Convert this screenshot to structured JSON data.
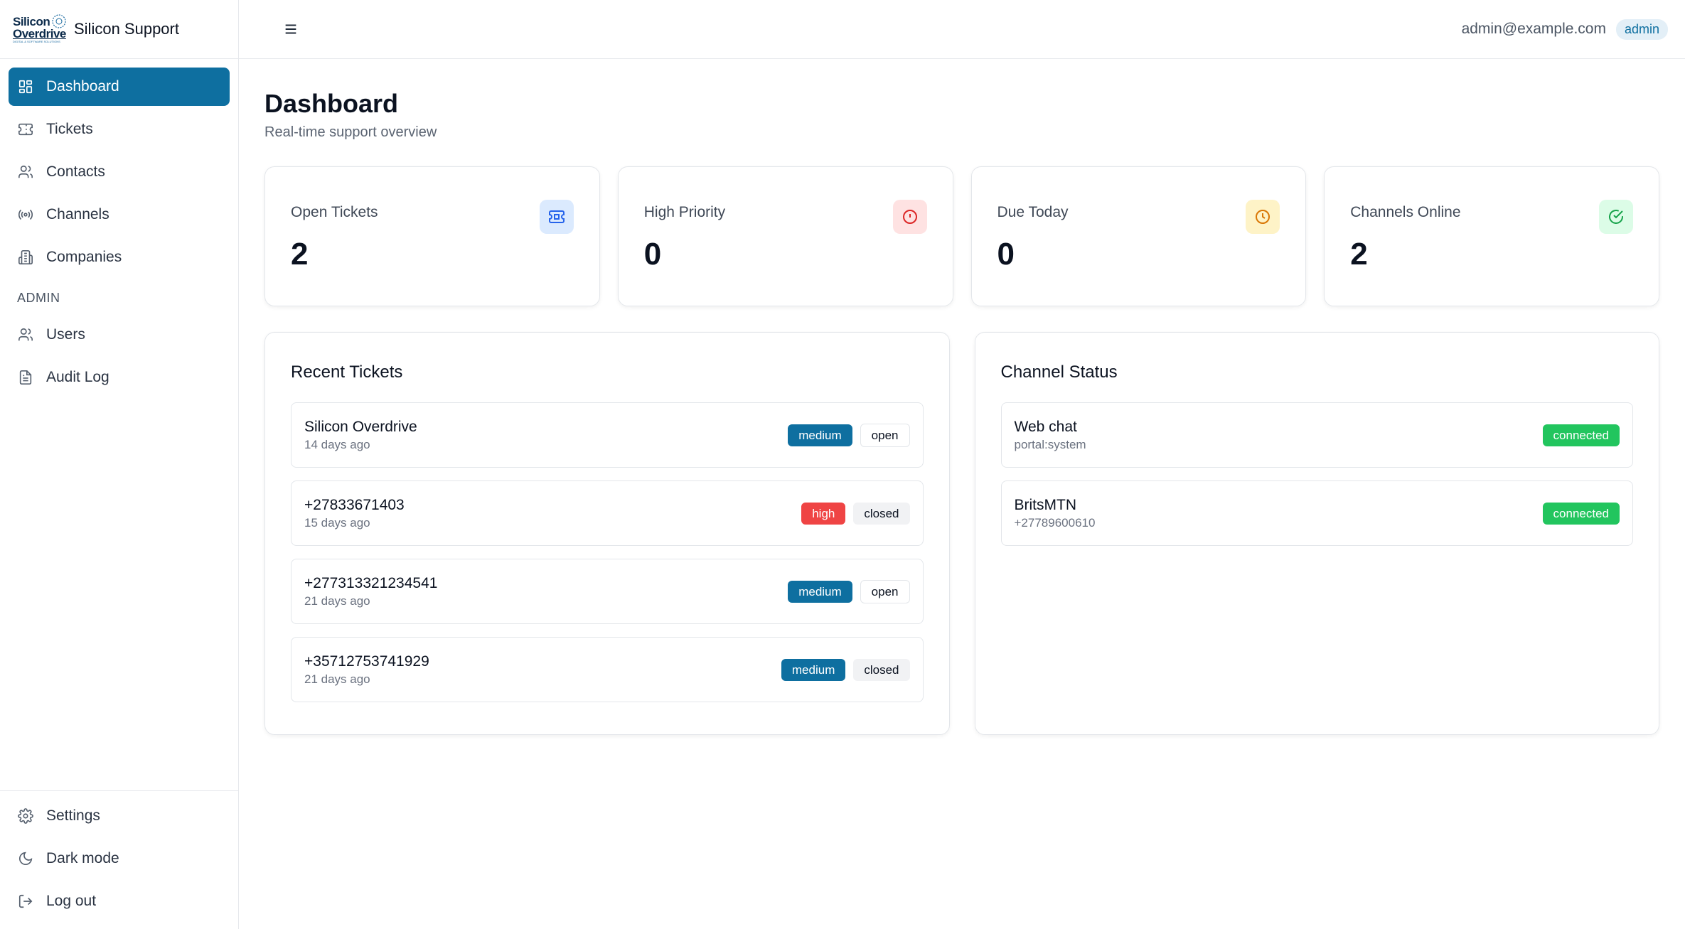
{
  "brand": {
    "logo_line1": "Silicon",
    "logo_line2": "Overdrive",
    "logo_tagline": "DIGITAL & SOFTWARE SOLUTIONS",
    "title": "Silicon Support"
  },
  "sidebar": {
    "items": [
      {
        "label": "Dashboard",
        "icon": "dashboard-icon"
      },
      {
        "label": "Tickets",
        "icon": "ticket-icon"
      },
      {
        "label": "Contacts",
        "icon": "users-icon"
      },
      {
        "label": "Channels",
        "icon": "radio-icon"
      },
      {
        "label": "Companies",
        "icon": "building-icon"
      }
    ],
    "admin_label": "ADMIN",
    "admin_items": [
      {
        "label": "Users",
        "icon": "users-icon"
      },
      {
        "label": "Audit Log",
        "icon": "document-icon"
      }
    ],
    "bottom_items": [
      {
        "label": "Settings",
        "icon": "gear-icon"
      },
      {
        "label": "Dark mode",
        "icon": "moon-icon"
      },
      {
        "label": "Log out",
        "icon": "logout-icon"
      }
    ]
  },
  "header": {
    "user_email": "admin@example.com",
    "role": "admin"
  },
  "page": {
    "title": "Dashboard",
    "subtitle": "Real-time support overview"
  },
  "stats": [
    {
      "label": "Open Tickets",
      "value": "2",
      "icon": "ticket-icon",
      "bg": "#dbeafe",
      "color": "#2563eb"
    },
    {
      "label": "High Priority",
      "value": "0",
      "icon": "alert-circle-icon",
      "bg": "#fee2e2",
      "color": "#dc2626"
    },
    {
      "label": "Due Today",
      "value": "0",
      "icon": "clock-icon",
      "bg": "#fef3c7",
      "color": "#d97706"
    },
    {
      "label": "Channels Online",
      "value": "2",
      "icon": "check-circle-icon",
      "bg": "#dcfce7",
      "color": "#16a34a"
    }
  ],
  "recent_tickets": {
    "title": "Recent Tickets",
    "items": [
      {
        "name": "Silicon Overdrive",
        "time": "14 days ago",
        "priority": "medium",
        "status": "open"
      },
      {
        "name": "+27833671403",
        "time": "15 days ago",
        "priority": "high",
        "status": "closed"
      },
      {
        "name": "+277313321234541",
        "time": "21 days ago",
        "priority": "medium",
        "status": "open"
      },
      {
        "name": "+35712753741929",
        "time": "21 days ago",
        "priority": "medium",
        "status": "closed"
      }
    ]
  },
  "channel_status": {
    "title": "Channel Status",
    "items": [
      {
        "name": "Web chat",
        "detail": "portal:system",
        "status": "connected"
      },
      {
        "name": "BritsMTN",
        "detail": "+27789600610",
        "status": "connected"
      }
    ]
  },
  "colors": {
    "accent": "#0e6fa0",
    "high": "#ef4444",
    "connected": "#22c55e"
  }
}
